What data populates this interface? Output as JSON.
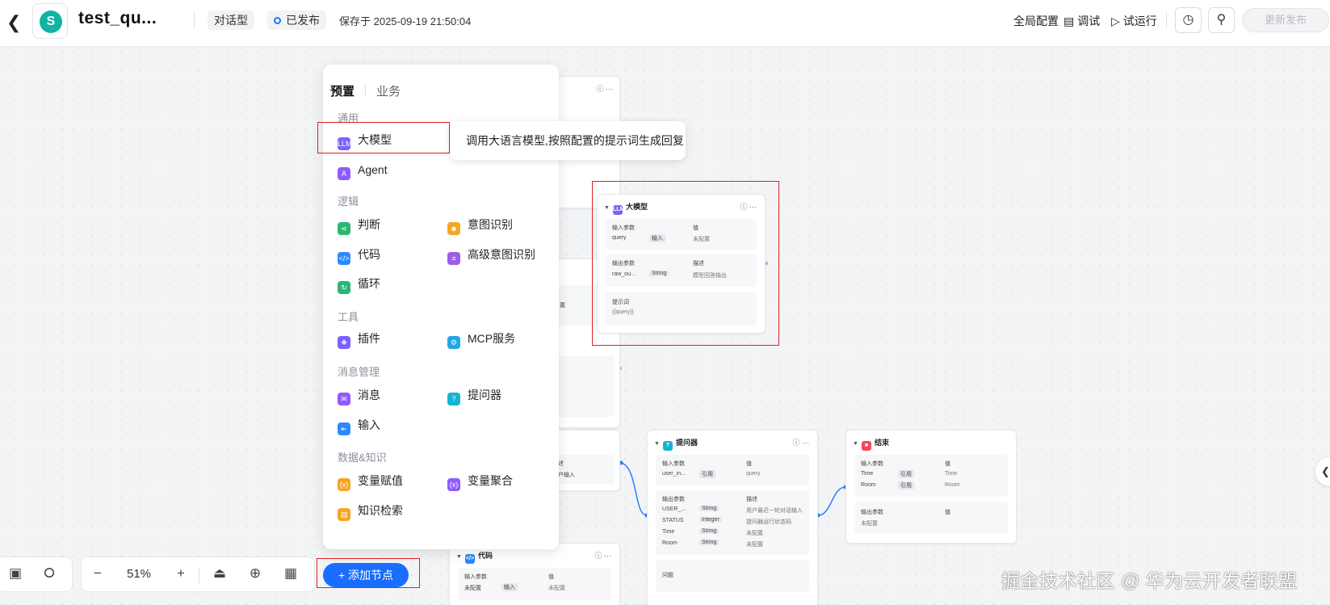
{
  "header": {
    "back_icon": "chevron-left-icon",
    "app_title": "test_qu...",
    "type_tag": "对话型",
    "status": "已发布",
    "saved_text": "保存于 2025-09-19 21:50:04",
    "global_config": "全局配置",
    "debug": "调试",
    "trial_run": "试运行",
    "publish": "更新发布"
  },
  "panel": {
    "tabs": [
      "预置",
      "业务"
    ],
    "categories": {
      "general": "通用",
      "logic": "逻辑",
      "tools": "工具",
      "message": "消息管理",
      "data": "数据&知识"
    },
    "items": {
      "llm": "大模型",
      "agent": "Agent",
      "judge": "判断",
      "intent": "意图识别",
      "code": "代码",
      "adv_intent": "高级意图识别",
      "loop": "循环",
      "plugin": "插件",
      "mcp": "MCP服务",
      "message": "消息",
      "questioner": "提问器",
      "input": "输入",
      "var_assign": "变量赋值",
      "var_aggregate": "变量聚合",
      "knowledge": "知识检索"
    },
    "tooltip": "调用大语言模型,按照配置的提示词生成回复"
  },
  "nodes": {
    "llm": {
      "title": "大模型",
      "input_label": "输入参数",
      "value_label": "值",
      "input_name": "query",
      "input_type": "输入",
      "input_value": "未配置",
      "output_label": "输出参数",
      "desc_label": "描述",
      "output_name": "raw_ou...",
      "output_type": "String",
      "output_desc": "模型回答输出",
      "prompt_label": "提示词",
      "prompt_value": "{{query}}"
    },
    "questioner": {
      "title": "提问器",
      "input_label": "输入参数",
      "value_label": "值",
      "input_name": "user_in...",
      "input_type": "引用",
      "input_value": "query",
      "output_label": "输出参数",
      "desc_label": "描述",
      "outputs": [
        {
          "name": "USER_...",
          "type": "String",
          "desc": "用户最近一轮对话输入"
        },
        {
          "name": "STATUS",
          "type": "Integer",
          "desc": "提问器运行状态码"
        },
        {
          "name": "Time",
          "type": "String",
          "desc": "未配置"
        },
        {
          "name": "Room",
          "type": "String",
          "desc": "未配置"
        }
      ],
      "question_label": "问题"
    },
    "end": {
      "title": "结束",
      "input_label": "输入参数",
      "value_label": "值",
      "inputs": [
        {
          "name": "Time",
          "type": "引用",
          "value": "Time"
        },
        {
          "name": "Room",
          "type": "引用",
          "value": "Room"
        }
      ],
      "output_label": "输出参数",
      "output_value_label": "值",
      "output_value": "未配置"
    },
    "code": {
      "title": "代码",
      "input_label": "输入参数",
      "value_label": "值",
      "input_name": "未配置",
      "input_type": "输入",
      "input_value": "未配置"
    },
    "partial": {
      "a": "置",
      "b": "述",
      "c": "户输入"
    }
  },
  "toolbar": {
    "zoom": "51%",
    "add_node": "添加节点",
    "add_icon": "+"
  },
  "watermark": "掘金技术社区 @ 华为云开发者联盟"
}
